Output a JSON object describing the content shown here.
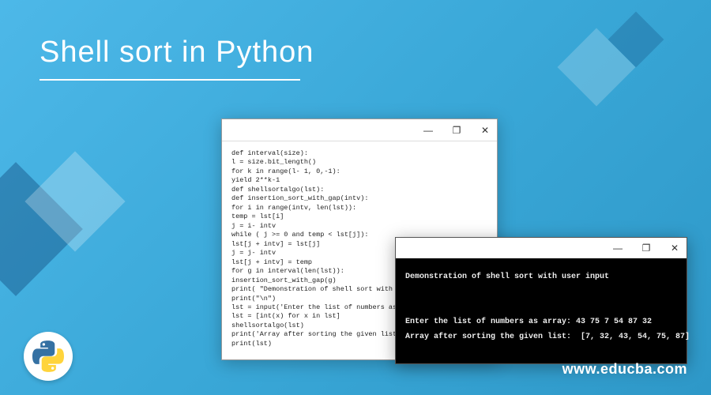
{
  "title": "Shell sort in Python",
  "website": "www.educba.com",
  "code_window": {
    "lines": "def interval(size):\nl = size.bit_length()\nfor k in range(l- 1, 0,-1):\nyield 2**k-1\ndef shellsortalgo(lst):\ndef insertion_sort_with_gap(intv):\nfor i in range(intv, len(lst)):\ntemp = lst[i]\nj = i- intv\nwhile ( j >= 0 and temp < lst[j]):\nlst[j + intv] = lst[j]\nj = j- intv\nlst[j + intv] = temp\nfor g in interval(len(lst)):\ninsertion_sort_with_gap(g)\nprint( \"Demonstration of shell sort with user input\" )\nprint(\"\\n\")\nlst = input('Enter the list of numbers as array: ').split()\nlst = [int(x) for x in lst]\nshellsortalgo(lst)\nprint('Array after sorting the given list: ', end='')\nprint(lst)"
  },
  "terminal": {
    "header": "Demonstration of shell sort with user input",
    "prompt": "Enter the list of numbers as array: 43 75 7 54 87 32",
    "result": "Array after sorting the given list:  [7, 32, 43, 54, 75, 87]"
  },
  "window_controls": {
    "minimize": "—",
    "maximize": "❐",
    "close": "✕"
  }
}
